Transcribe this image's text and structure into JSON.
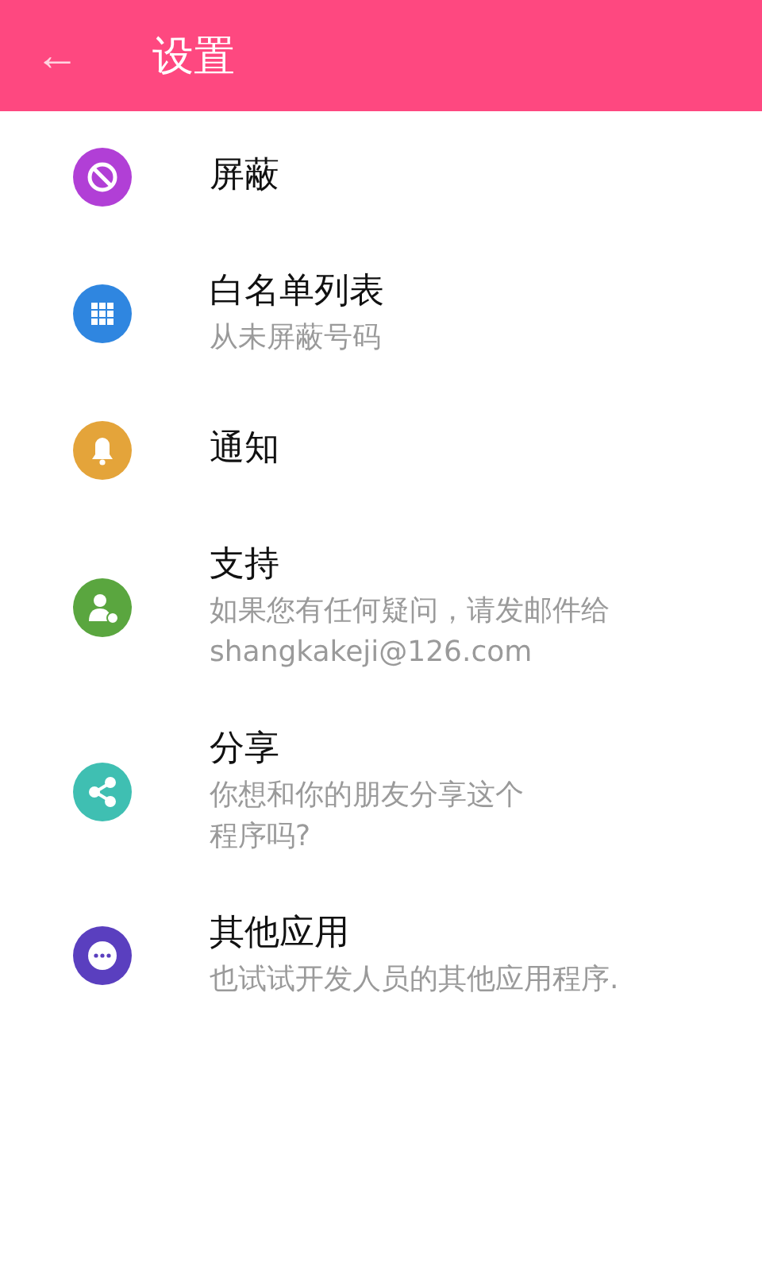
{
  "app_bar": {
    "back_icon": "←",
    "title": "设置"
  },
  "items": [
    {
      "kind": "block",
      "color": "#b13fd6",
      "title": "屏蔽"
    },
    {
      "kind": "grid",
      "color": "#2f86e0",
      "title": "白名单列表",
      "subtitle": "从未屏蔽号码"
    },
    {
      "kind": "bell",
      "color": "#e4a43a",
      "title": "通知"
    },
    {
      "kind": "support",
      "color": "#5aa63f",
      "title": "支持",
      "subtitle": "如果您有任何疑问，请发邮件给shangkakeji@126.com"
    },
    {
      "kind": "share",
      "color": "#3fbfb2",
      "title": "分享",
      "subtitle": "你想和你的朋友分享这个程序吗?"
    },
    {
      "kind": "more",
      "color": "#5a3fbf",
      "title": "其他应用",
      "subtitle": "也试试开发人员的其他应用程序."
    }
  ]
}
